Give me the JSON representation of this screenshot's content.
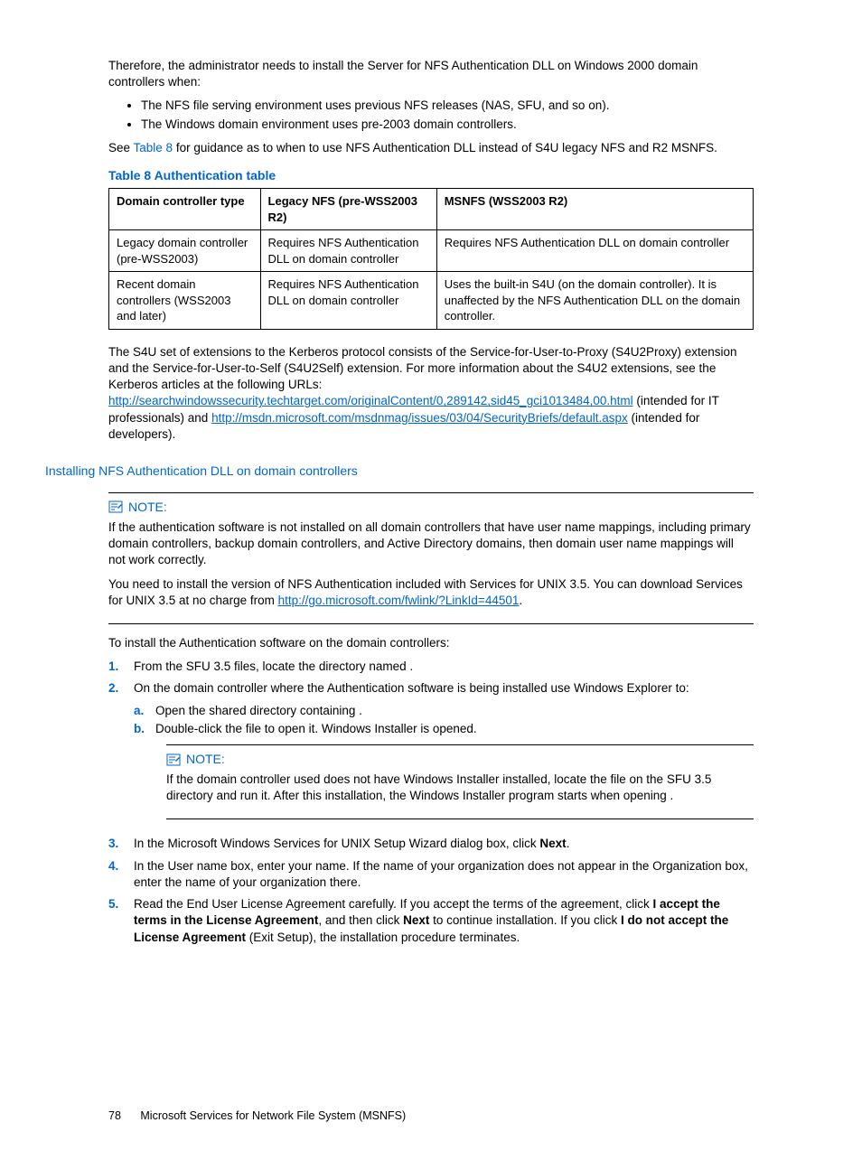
{
  "intro": {
    "p1": "Therefore, the administrator needs to install the Server for NFS Authentication DLL on Windows 2000 domain controllers when:",
    "bullets": [
      "The NFS file serving environment uses previous NFS releases (NAS, SFU, and so on).",
      "The Windows domain environment uses pre-2003 domain controllers."
    ],
    "p2_a": "See ",
    "p2_link": "Table 8",
    "p2_b": " for guidance as to when to use NFS Authentication DLL instead of S4U legacy NFS and R2 MSNFS."
  },
  "table": {
    "caption": "Table 8 Authentication table",
    "headers": [
      "Domain controller type",
      "Legacy NFS (pre-WSS2003 R2)",
      "MSNFS (WSS2003 R2)"
    ],
    "rows": [
      [
        "Legacy domain controller (pre-WSS2003)",
        "Requires NFS Authentication DLL on domain controller",
        "Requires NFS Authentication DLL on domain controller"
      ],
      [
        "Recent domain controllers (WSS2003 and later)",
        "Requires NFS Authentication DLL on domain controller",
        "Uses the built-in S4U (on the domain controller). It is unaffected by the NFS Authentication DLL on the domain controller."
      ]
    ]
  },
  "s4u": {
    "p_a": "The S4U set of extensions to the Kerberos protocol consists of the Service-for-User-to-Proxy (S4U2Proxy) extension and the Service-for-User-to-Self (S4U2Self) extension. For more information about the S4U2 extensions, see the Kerberos articles at the following URLs: ",
    "link1": "http://searchwindowssecurity.techtarget.com/originalContent/0,289142,sid45_gci1013484,00.html",
    "p_b": " (intended for IT professionals) and ",
    "link2": "http://msdn.microsoft.com/msdnmag/issues/03/04/SecurityBriefs/default.aspx",
    "p_c": " (intended for developers)."
  },
  "section_heading": "Installing NFS Authentication DLL on domain controllers",
  "note1": {
    "label": "NOTE:",
    "p1": "If the authentication software is not installed on all domain controllers that have user name mappings, including primary domain controllers, backup domain controllers, and Active Directory domains, then domain user name mappings will not work correctly.",
    "p2_a": "You need to install the version of NFS Authentication included with Services for UNIX 3.5. You can download Services for UNIX 3.5 at no charge from ",
    "p2_link": "http://go.microsoft.com/fwlink/?LinkId=44501",
    "p2_b": "."
  },
  "install_intro": "To install the Authentication software on the domain controllers:",
  "steps": {
    "s1": {
      "num": "1.",
      "text": "From the SFU 3.5 files, locate the directory named                              ."
    },
    "s2": {
      "num": "2.",
      "text": "On the domain controller where the Authentication software is being installed use Windows Explorer to:",
      "sub_a": {
        "letter": "a.",
        "text": "Open the shared directory containing                          ."
      },
      "sub_b": {
        "letter": "b.",
        "text": "Double-click the file to open it. Windows Installer is opened."
      }
    },
    "s3": {
      "num": "3.",
      "text_a": "In the Microsoft Windows Services for UNIX Setup Wizard dialog box, click ",
      "bold": "Next",
      "text_b": "."
    },
    "s4": {
      "num": "4.",
      "text": "In the User name box, enter your name. If the name of your organization does not appear in the Organization box, enter the name of your organization there."
    },
    "s5": {
      "num": "5.",
      "t1": "Read the End User License Agreement carefully. If you accept the terms of the agreement, click ",
      "b1": "I accept the terms in the License Agreement",
      "t2": ", and then click ",
      "b2": "Next",
      "t3": " to continue installation. If you click ",
      "b3": "I do not accept the License Agreement",
      "t4": " (Exit Setup), the installation procedure terminates."
    }
  },
  "note2": {
    "label": "NOTE:",
    "p": "If the domain controller used does not have Windows Installer installed, locate the file                          on the SFU 3.5 directory and run it. After this installation, the Windows Installer program starts when opening                          ."
  },
  "footer": {
    "page": "78",
    "title": "Microsoft Services for Network File System (MSNFS)"
  }
}
